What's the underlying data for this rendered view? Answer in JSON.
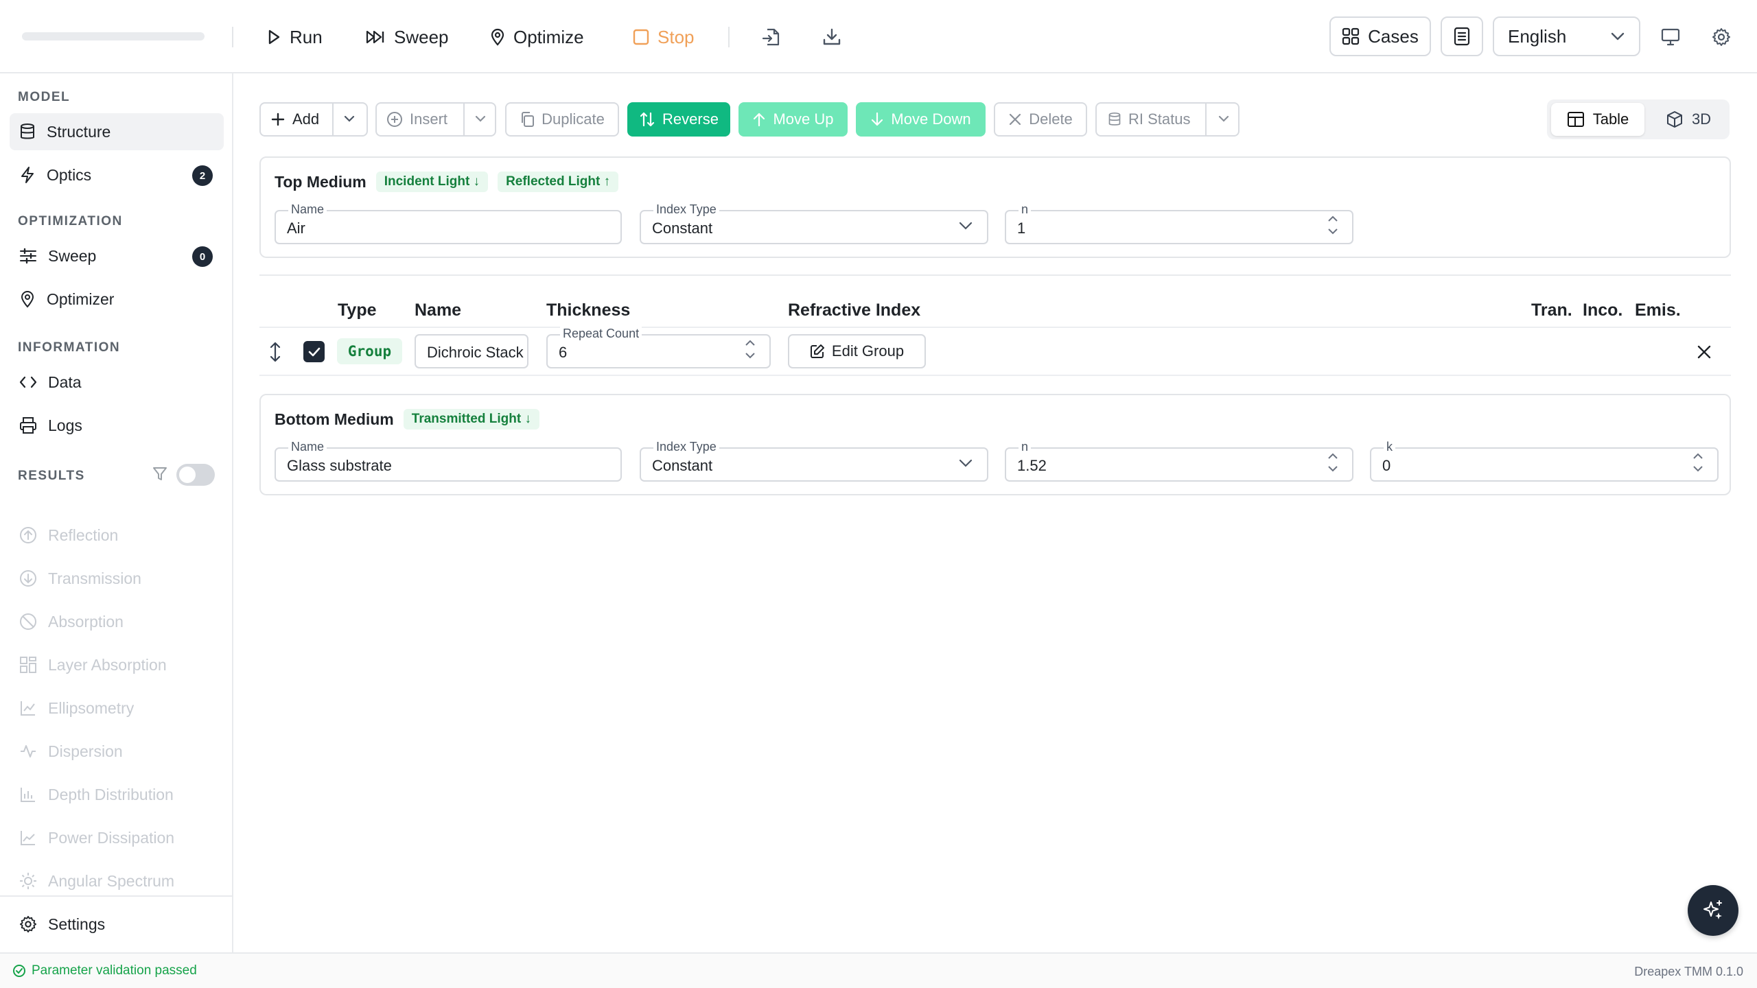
{
  "toolbar": {
    "run": "Run",
    "sweep": "Sweep",
    "optimize": "Optimize",
    "stop": "Stop",
    "cases": "Cases",
    "language": "English"
  },
  "sidebar": {
    "model_title": "MODEL",
    "structure": "Structure",
    "optics": "Optics",
    "optics_badge": "2",
    "optimization_title": "OPTIMIZATION",
    "sweep": "Sweep",
    "sweep_badge": "0",
    "optimizer": "Optimizer",
    "information_title": "INFORMATION",
    "data": "Data",
    "logs": "Logs",
    "results_title": "RESULTS",
    "results": [
      "Reflection",
      "Transmission",
      "Absorption",
      "Layer Absorption",
      "Ellipsometry",
      "Dispersion",
      "Depth Distribution",
      "Power Dissipation",
      "Angular Spectrum"
    ],
    "settings": "Settings"
  },
  "actions": {
    "add": "Add",
    "insert": "Insert",
    "duplicate": "Duplicate",
    "reverse": "Reverse",
    "move_up": "Move Up",
    "move_down": "Move Down",
    "delete": "Delete",
    "ri_status": "RI Status"
  },
  "view": {
    "table": "Table",
    "three_d": "3D"
  },
  "top_medium": {
    "title": "Top Medium",
    "tag_incident": "Incident Light ↓",
    "tag_reflected": "Reflected Light ↑",
    "name_label": "Name",
    "name": "Air",
    "index_type_label": "Index Type",
    "index_type": "Constant",
    "n_label": "n",
    "n": "1"
  },
  "table": {
    "headers": {
      "type": "Type",
      "name": "Name",
      "thickness": "Thickness",
      "refractive_index": "Refractive Index",
      "tran": "Tran.",
      "inco": "Inco.",
      "emis": "Emis."
    },
    "rows": [
      {
        "type": "Group",
        "name": "Dichroic Stack",
        "repeat_label": "Repeat Count",
        "repeat": "6",
        "edit": "Edit Group"
      }
    ]
  },
  "bottom_medium": {
    "title": "Bottom Medium",
    "tag_transmitted": "Transmitted Light ↓",
    "name_label": "Name",
    "name": "Glass substrate",
    "index_type_label": "Index Type",
    "index_type": "Constant",
    "n_label": "n",
    "n": "1.52",
    "k_label": "k",
    "k": "0"
  },
  "status": {
    "message": "Parameter validation passed",
    "version": "Dreapex TMM 0.1.0"
  },
  "colors": {
    "accent": "#10b981",
    "accent_light": "#6ee7b7",
    "badge": "#1f2937",
    "stop": "#f0a058",
    "ok": "#16a34a"
  }
}
